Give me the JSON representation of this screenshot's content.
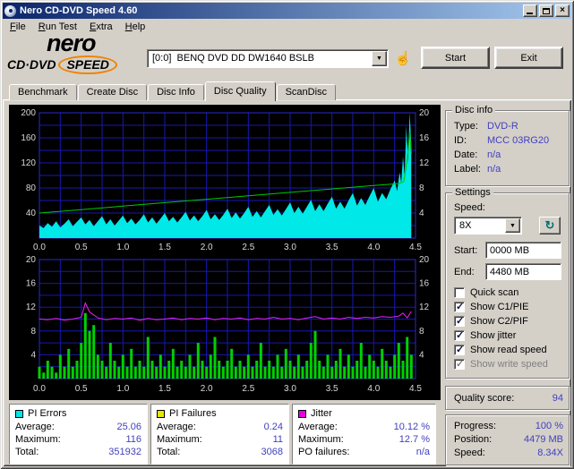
{
  "window": {
    "title": "Nero CD-DVD Speed 4.60"
  },
  "menu": [
    "File",
    "Run Test",
    "Extra",
    "Help"
  ],
  "toolbar": {
    "logo": {
      "nero": "nero",
      "sub": "CD·DVD",
      "speed": "SPEED"
    },
    "drive_select": "[0:0]  BENQ DVD DD DW1640 BSLB",
    "start_label": "Start",
    "exit_label": "Exit"
  },
  "icons": {
    "close": "×",
    "dropdown": "▼",
    "hand": "☝",
    "refresh": "↻",
    "check": "✓"
  },
  "tabs": [
    {
      "label": "Benchmark",
      "active": false
    },
    {
      "label": "Create Disc",
      "active": false
    },
    {
      "label": "Disc Info",
      "active": false
    },
    {
      "label": "Disc Quality",
      "active": true
    },
    {
      "label": "ScanDisc",
      "active": false
    }
  ],
  "disc_info": {
    "title": "Disc info",
    "rows": [
      {
        "label": "Type:",
        "value": "DVD-R"
      },
      {
        "label": "ID:",
        "value": "MCC 03RG20"
      },
      {
        "label": "Date:",
        "value": "n/a"
      },
      {
        "label": "Label:",
        "value": "n/a"
      }
    ]
  },
  "settings": {
    "title": "Settings",
    "speed_label": "Speed:",
    "speed_value": "8X",
    "start_label": "Start:",
    "start_value": "0000 MB",
    "end_label": "End:",
    "end_value": "4480 MB",
    "checkboxes": [
      {
        "label": "Quick scan",
        "checked": false,
        "enabled": true
      },
      {
        "label": "Show C1/PIE",
        "checked": true,
        "enabled": true
      },
      {
        "label": "Show C2/PIF",
        "checked": true,
        "enabled": true
      },
      {
        "label": "Show jitter",
        "checked": true,
        "enabled": true
      },
      {
        "label": "Show read speed",
        "checked": true,
        "enabled": true
      },
      {
        "label": "Show write speed",
        "checked": true,
        "enabled": false
      }
    ]
  },
  "quality": {
    "label": "Quality score:",
    "value": "94"
  },
  "progress": {
    "rows": [
      {
        "label": "Progress:",
        "value": "100 %"
      },
      {
        "label": "Position:",
        "value": "4479 MB"
      },
      {
        "label": "Speed:",
        "value": "8.34X"
      }
    ]
  },
  "stats_panels": [
    {
      "title": "PI Errors",
      "color": "#00e6e6",
      "rows": [
        {
          "label": "Average:",
          "value": "25.06"
        },
        {
          "label": "Maximum:",
          "value": "116"
        },
        {
          "label": "Total:",
          "value": "351932"
        }
      ]
    },
    {
      "title": "PI Failures",
      "color": "#e6e600",
      "rows": [
        {
          "label": "Average:",
          "value": "0.24"
        },
        {
          "label": "Maximum:",
          "value": "11"
        },
        {
          "label": "Total:",
          "value": "3068"
        }
      ]
    },
    {
      "title": "Jitter",
      "color": "#e600e6",
      "rows": [
        {
          "label": "Average:",
          "value": "10.12 %"
        },
        {
          "label": "Maximum:",
          "value": "12.7 %"
        },
        {
          "label": "PO failures:",
          "value": "n/a"
        }
      ]
    }
  ],
  "chart_data": [
    {
      "type": "area",
      "title": "PI Errors / read speed vs position (GB)",
      "x_max": 4.5,
      "x_ticks": [
        0,
        0.5,
        1,
        1.5,
        2,
        2.5,
        3,
        3.5,
        4,
        4.5
      ],
      "left_axis": {
        "max": 200,
        "grid_step": 20,
        "label_ticks": [
          40,
          80,
          120,
          160,
          200
        ]
      },
      "right_axis": {
        "max": 20,
        "label_ticks": [
          4,
          8,
          12,
          16,
          20
        ]
      },
      "series": [
        {
          "name": "pi-errors",
          "type": "area",
          "color": "#00e8e8",
          "axis_max": 200,
          "x": [
            0,
            0.05,
            0.1,
            0.15,
            0.2,
            0.25,
            0.3,
            0.35,
            0.4,
            0.45,
            0.5,
            0.55,
            0.6,
            0.65,
            0.7,
            0.75,
            0.8,
            0.85,
            0.9,
            0.95,
            1,
            1.05,
            1.1,
            1.15,
            1.2,
            1.25,
            1.3,
            1.35,
            1.4,
            1.45,
            1.5,
            1.55,
            1.6,
            1.65,
            1.7,
            1.75,
            1.8,
            1.85,
            1.9,
            1.95,
            2,
            2.05,
            2.1,
            2.15,
            2.2,
            2.25,
            2.3,
            2.35,
            2.4,
            2.45,
            2.5,
            2.55,
            2.6,
            2.65,
            2.7,
            2.75,
            2.8,
            2.85,
            2.9,
            2.95,
            3,
            3.05,
            3.1,
            3.15,
            3.2,
            3.25,
            3.3,
            3.35,
            3.4,
            3.45,
            3.5,
            3.55,
            3.6,
            3.65,
            3.7,
            3.75,
            3.8,
            3.85,
            3.9,
            3.95,
            4,
            4.05,
            4.1,
            4.15,
            4.2,
            4.25,
            4.28,
            4.31,
            4.33,
            4.35,
            4.37,
            4.39,
            4.41,
            4.43,
            4.45
          ],
          "v": [
            20,
            16,
            24,
            18,
            27,
            17,
            23,
            30,
            19,
            26,
            33,
            22,
            29,
            19,
            27,
            35,
            22,
            30,
            20,
            28,
            36,
            24,
            31,
            22,
            29,
            38,
            25,
            33,
            23,
            31,
            40,
            27,
            34,
            25,
            33,
            42,
            28,
            36,
            27,
            35,
            45,
            30,
            38,
            29,
            37,
            47,
            32,
            41,
            31,
            40,
            50,
            34,
            43,
            33,
            43,
            53,
            37,
            46,
            36,
            46,
            57,
            40,
            50,
            39,
            50,
            61,
            43,
            54,
            43,
            55,
            66,
            47,
            58,
            47,
            60,
            72,
            52,
            64,
            53,
            67,
            80,
            58,
            72,
            62,
            78,
            92,
            75,
            105,
            88,
            130,
            100,
            180,
            120,
            200,
            150
          ]
        },
        {
          "name": "read-speed",
          "type": "line",
          "color": "#00c800",
          "axis_max": 20,
          "x": [
            0,
            0.5,
            1,
            1.5,
            2,
            2.5,
            3,
            3.5,
            4,
            4.3,
            4.36,
            4.4,
            4.43,
            4.45
          ],
          "v": [
            4,
            4.55,
            5.1,
            5.65,
            6.2,
            6.75,
            7.3,
            7.85,
            8.4,
            8.7,
            9,
            12.5,
            17,
            13.5
          ]
        }
      ]
    },
    {
      "type": "bar",
      "title": "PI Failures / jitter vs position (GB)",
      "x_max": 4.5,
      "x_ticks": [
        0,
        0.5,
        1,
        1.5,
        2,
        2.5,
        3,
        3.5,
        4,
        4.5
      ],
      "left_axis": {
        "max": 20,
        "grid_step": 2,
        "label_ticks": [
          4,
          8,
          12,
          16,
          20
        ]
      },
      "right_axis": {
        "max": 20,
        "label_ticks": [
          4,
          8,
          12,
          16,
          20
        ]
      },
      "series": [
        {
          "name": "pi-failures",
          "type": "bars",
          "color": "#00d000",
          "axis_max": 20,
          "x": [
            0,
            0.05,
            0.1,
            0.15,
            0.2,
            0.25,
            0.3,
            0.35,
            0.4,
            0.45,
            0.5,
            0.55,
            0.6,
            0.65,
            0.7,
            0.75,
            0.8,
            0.85,
            0.9,
            0.95,
            1,
            1.05,
            1.1,
            1.15,
            1.2,
            1.25,
            1.3,
            1.35,
            1.4,
            1.45,
            1.5,
            1.55,
            1.6,
            1.65,
            1.7,
            1.75,
            1.8,
            1.85,
            1.9,
            1.95,
            2,
            2.05,
            2.1,
            2.15,
            2.2,
            2.25,
            2.3,
            2.35,
            2.4,
            2.45,
            2.5,
            2.55,
            2.6,
            2.65,
            2.7,
            2.75,
            2.8,
            2.85,
            2.9,
            2.95,
            3,
            3.05,
            3.1,
            3.15,
            3.2,
            3.25,
            3.3,
            3.35,
            3.4,
            3.45,
            3.5,
            3.55,
            3.6,
            3.65,
            3.7,
            3.75,
            3.8,
            3.85,
            3.9,
            3.95,
            4,
            4.05,
            4.1,
            4.15,
            4.2,
            4.25,
            4.3,
            4.35,
            4.4,
            4.45
          ],
          "v": [
            2,
            1,
            3,
            2,
            1,
            4,
            2,
            5,
            2,
            3,
            6,
            11,
            8,
            9,
            4,
            3,
            2,
            6,
            3,
            2,
            4,
            2,
            5,
            2,
            3,
            2,
            7,
            3,
            2,
            4,
            2,
            3,
            5,
            2,
            3,
            2,
            4,
            2,
            6,
            3,
            2,
            4,
            7,
            3,
            2,
            3,
            5,
            2,
            3,
            2,
            4,
            2,
            3,
            6,
            2,
            3,
            2,
            4,
            2,
            5,
            3,
            2,
            4,
            2,
            3,
            6,
            8,
            3,
            2,
            4,
            2,
            3,
            5,
            2,
            4,
            2,
            3,
            6,
            2,
            4,
            3,
            2,
            5,
            3,
            2,
            4,
            6,
            3,
            7,
            4
          ]
        },
        {
          "name": "jitter",
          "type": "line",
          "color": "#ee22ee",
          "axis_max": 20,
          "x": [
            0,
            0.1,
            0.2,
            0.3,
            0.4,
            0.5,
            0.55,
            0.6,
            0.7,
            0.8,
            0.9,
            1,
            1.1,
            1.2,
            1.3,
            1.4,
            1.5,
            1.6,
            1.7,
            1.8,
            1.9,
            2,
            2.1,
            2.2,
            2.3,
            2.4,
            2.5,
            2.6,
            2.7,
            2.8,
            2.9,
            3,
            3.1,
            3.2,
            3.3,
            3.4,
            3.5,
            3.6,
            3.7,
            3.8,
            3.9,
            4,
            4.1,
            4.2,
            4.3,
            4.35,
            4.4,
            4.45
          ],
          "v": [
            10,
            9.9,
            10.1,
            9.8,
            10,
            10.3,
            12.7,
            11.2,
            10.2,
            9.9,
            10.1,
            10,
            10.2,
            9.8,
            10.1,
            9.9,
            10,
            10.2,
            9.9,
            10.1,
            10,
            10.2,
            9.9,
            10.1,
            10,
            10.2,
            9.9,
            10.1,
            10,
            10.3,
            10,
            10.1,
            9.9,
            10.2,
            10.4,
            10,
            10.2,
            10,
            10.3,
            10.1,
            10.3,
            10.2,
            10.4,
            10.3,
            10.5,
            11,
            10.2,
            11.3
          ]
        }
      ]
    }
  ]
}
